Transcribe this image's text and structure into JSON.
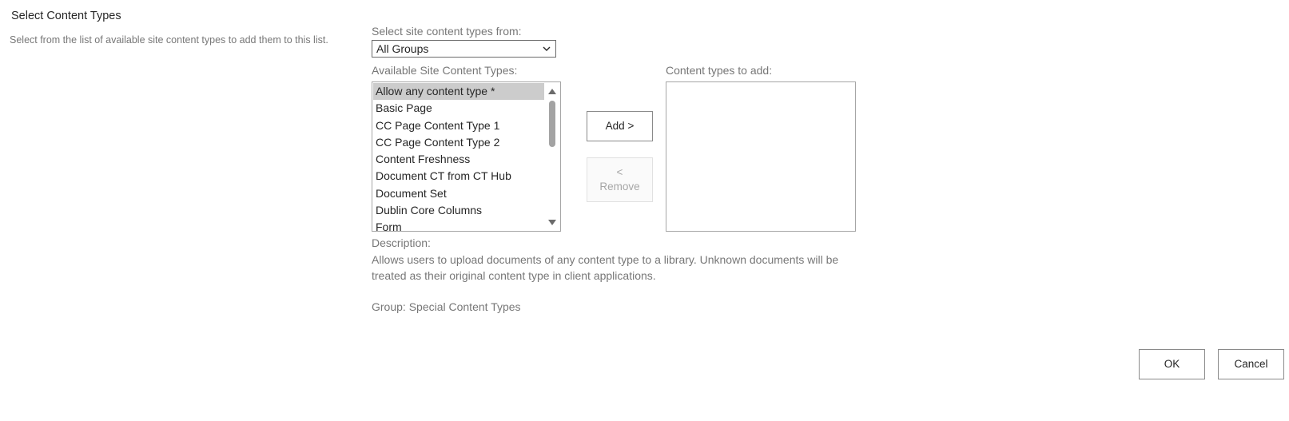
{
  "section": {
    "title": "Select Content Types",
    "description": "Select from the list of available site content types to add them to this list."
  },
  "source": {
    "label": "Select site content types from:",
    "selected": "All Groups"
  },
  "available": {
    "label": "Available Site Content Types:",
    "items": [
      "Allow any content type *",
      "Basic Page",
      "CC Page Content Type 1",
      "CC Page Content Type 2",
      "Content Freshness",
      "Document CT from CT Hub",
      "Document Set",
      "Dublin Core Columns",
      "Form"
    ],
    "selected_index": 0
  },
  "buttons": {
    "add": "Add >",
    "remove_arrow": "<",
    "remove": "Remove",
    "ok": "OK",
    "cancel": "Cancel"
  },
  "target": {
    "label": "Content types to add:"
  },
  "description": {
    "label": "Description:",
    "text": "Allows users to upload documents of any content type to a library. Unknown documents will be treated as their original content type in client applications.",
    "group": "Group: Special Content Types"
  },
  "colors": {
    "selected_item_bg": "#cccccc",
    "muted_text": "#777777",
    "primary_text": "#262626",
    "scroll_thumb": "#a3a3a3"
  },
  "icons": {
    "dropdown": "chevron-down-icon",
    "scroll_up": "triangle-up-icon",
    "scroll_down": "triangle-down-icon"
  }
}
